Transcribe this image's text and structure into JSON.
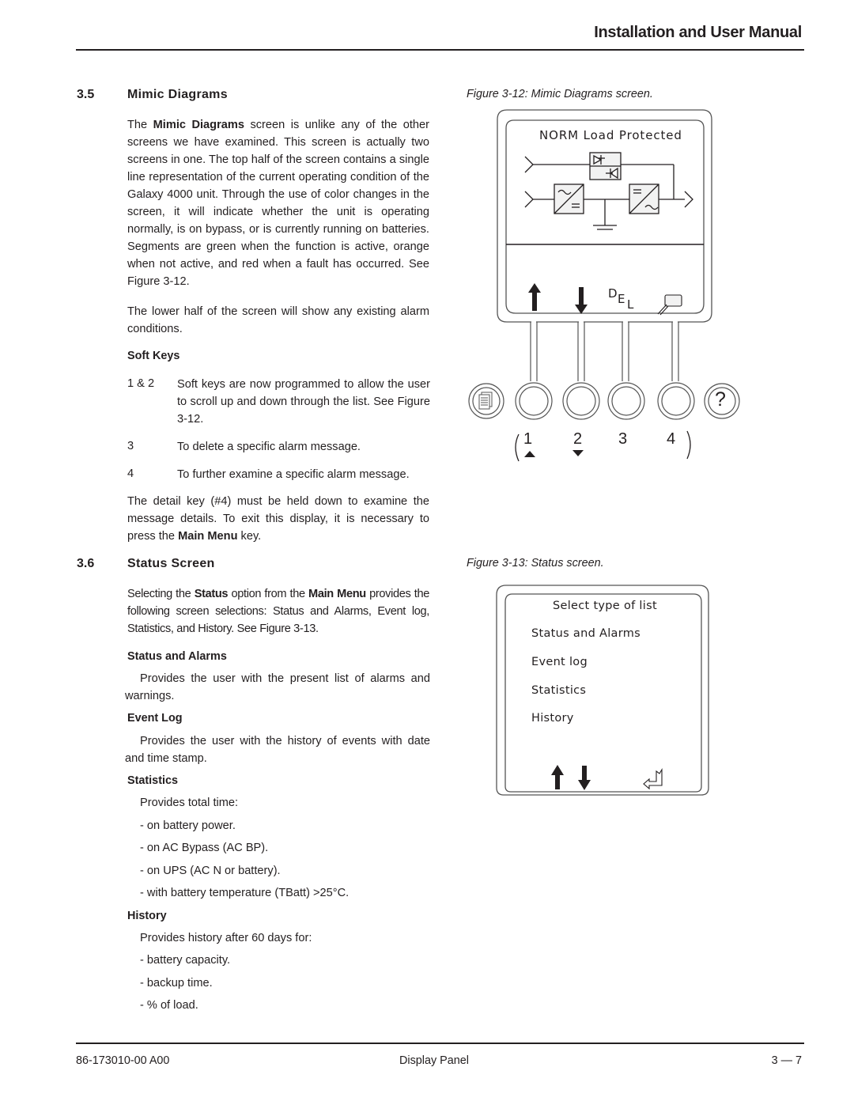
{
  "header": {
    "title": "Installation and User Manual"
  },
  "section_3_5": {
    "number": "3.5",
    "title": "Mimic Diagrams",
    "para1": {
      "pre": "The ",
      "bold": "Mimic Diagrams",
      "post": " screen is unlike any of the other screens we have examined. This screen is actually two screens in one. The top half of the screen contains a single line representation of the current operating condition of the Galaxy 4000 unit. Through the use of color changes in the screen, it will indicate whether the unit is operating normally, is on bypass, or is currently running on batteries. Segments are green when the function is active, orange when not active, and red when a fault has occurred. See Figure 3-12."
    },
    "para2": "The lower half of the screen will show any existing alarm conditions.",
    "soft_keys_heading": "Soft Keys",
    "soft_keys": [
      {
        "key": "1 & 2",
        "desc": "Soft keys are now programmed to allow the user to scroll up and down through the list. See Figure 3-12."
      },
      {
        "key": "3",
        "desc": "To delete a specific alarm message."
      },
      {
        "key": "4",
        "desc": "To further examine a specific alarm message."
      }
    ],
    "para3": {
      "pre": "The detail key (#4) must be held down to examine the message details. To exit this display, it is necessary to press the ",
      "bold": "Main Menu",
      "post": " key."
    }
  },
  "section_3_6": {
    "number": "3.6",
    "title": "Status Screen",
    "intro": {
      "pre": "Selecting the ",
      "bold1": "Status",
      "mid": " option from the ",
      "bold2": "Main Menu",
      "post": " provides the following screen selections: Status and Alarms, Event log, Statistics, and History. See Figure 3-13."
    },
    "status_alarms": {
      "heading": "Status and Alarms",
      "text": "Provides the user with the present list of alarms and warnings."
    },
    "event_log": {
      "heading": "Event Log",
      "text": "Provides the user with the history of events with date and time stamp."
    },
    "statistics": {
      "heading": "Statistics",
      "intro": "Provides total time:",
      "items": [
        "- on battery power.",
        "- on AC Bypass (AC BP).",
        "- on UPS (AC N or battery).",
        "- with battery temperature (TBatt) >25°C."
      ]
    },
    "history": {
      "heading": "History",
      "intro": "Provides history after 60 days for:",
      "items": [
        "- battery capacity.",
        "- backup time.",
        "- % of load."
      ]
    }
  },
  "figure_3_12": {
    "caption": "Figure 3-12:  Mimic Diagrams screen.",
    "status_text": "NORM Load Protected",
    "del_label": {
      "d": "D",
      "e": "E",
      "l": "L"
    },
    "softkey_numbers": [
      "1",
      "2",
      "3",
      "4"
    ],
    "icons": [
      "arrow-up-icon",
      "arrow-down-icon",
      "delete-icon",
      "magnify-detail-icon",
      "document-icon",
      "help-icon",
      "triangle-up-icon",
      "triangle-down-icon"
    ],
    "help_glyph": "?"
  },
  "figure_3_13": {
    "caption": "Figure 3-13:  Status screen.",
    "title": "Select type of list",
    "items": [
      "Status and Alarms",
      "Event log",
      "Statistics",
      "History"
    ],
    "icons": [
      "arrow-up-icon",
      "arrow-down-icon",
      "enter-icon"
    ]
  },
  "footer": {
    "doc_number": "86-173010-00 A00",
    "section": "Display Panel",
    "page": "3 — 7"
  }
}
